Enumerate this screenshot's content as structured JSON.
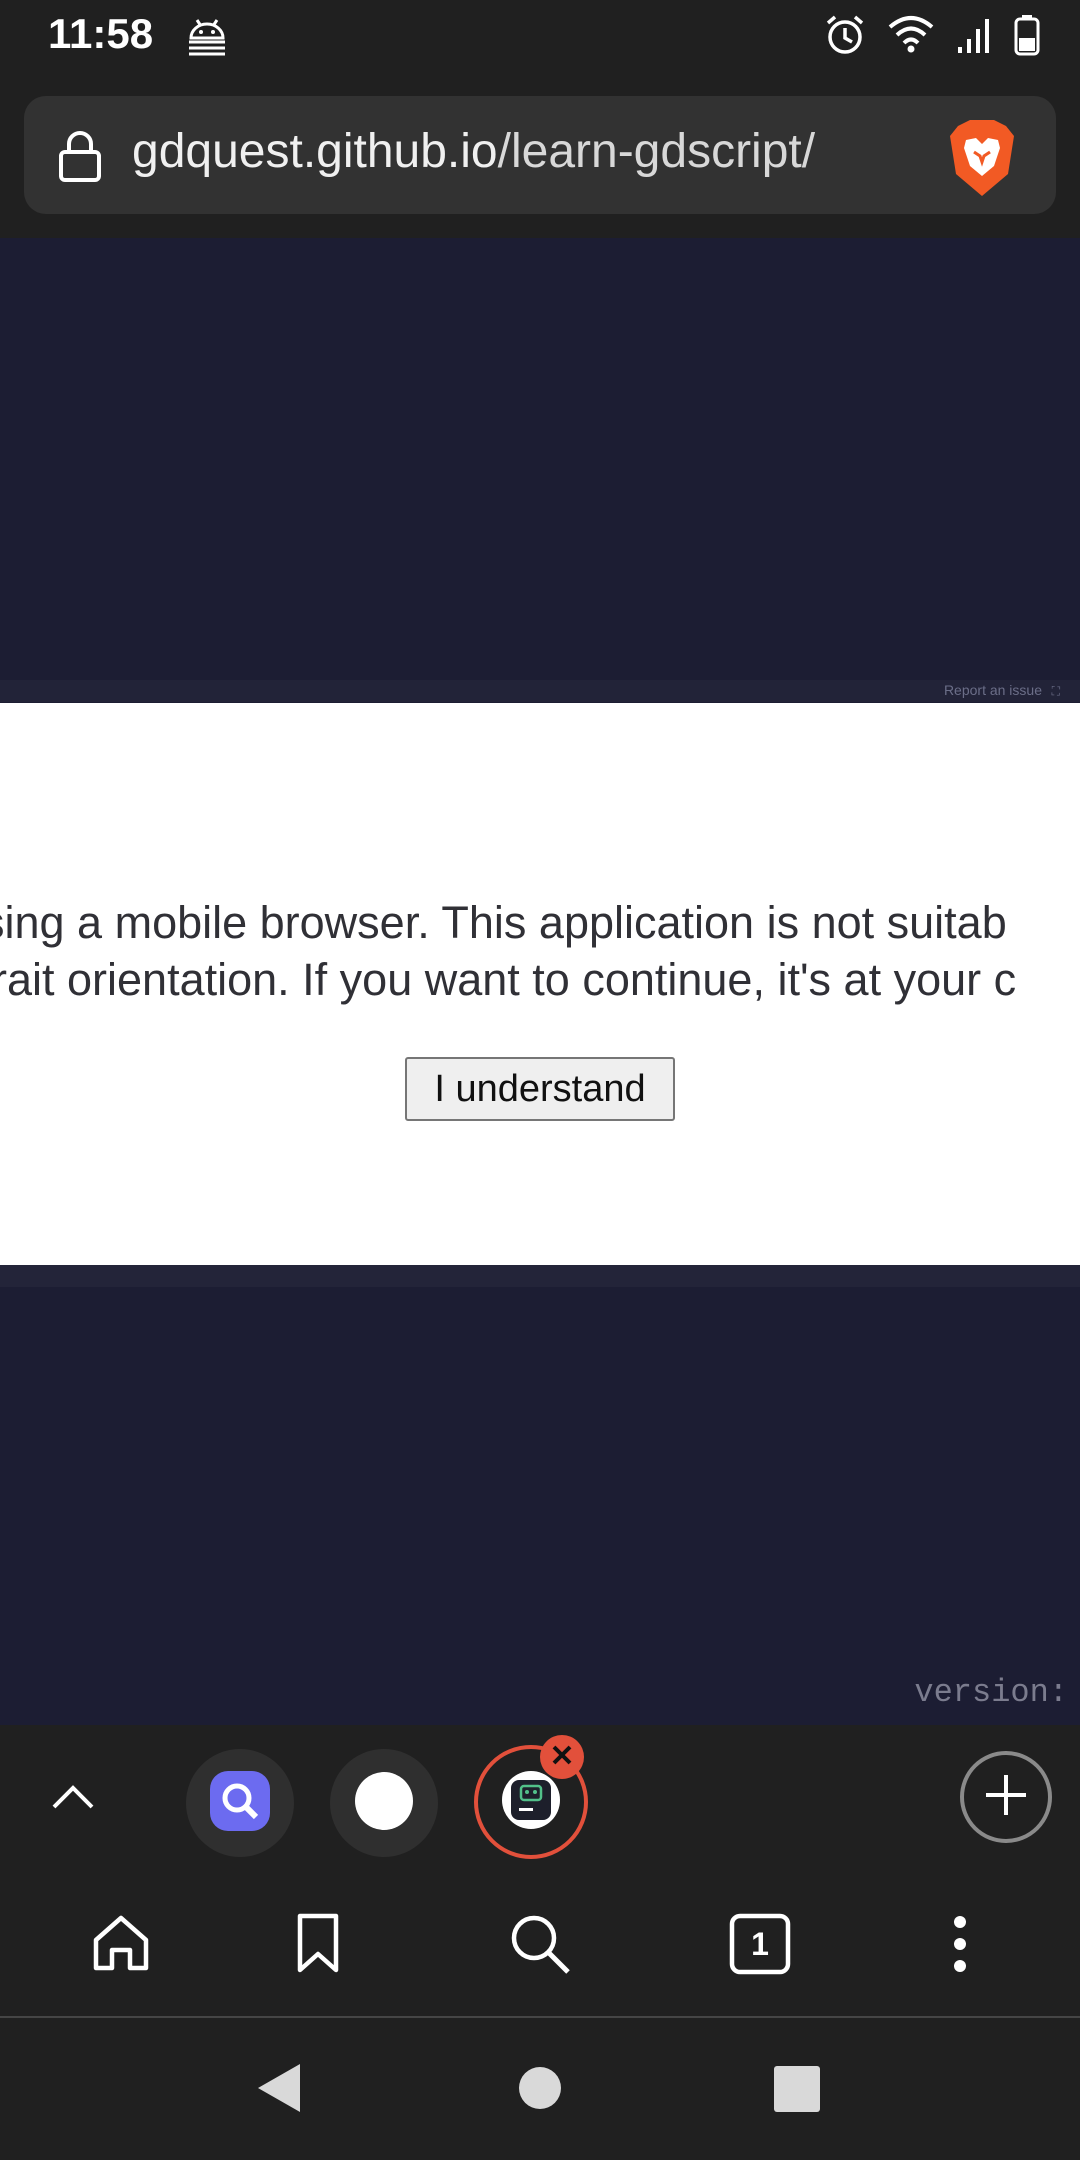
{
  "status_bar": {
    "time": "11:58",
    "icons": [
      "android-debug-icon",
      "alarm-icon",
      "wifi-icon",
      "signal-icon",
      "battery-icon"
    ]
  },
  "address_bar": {
    "domain": "gdquest.github.io",
    "path": "/learn-gdscript/",
    "icons": [
      "lock-icon",
      "brave-lion-icon"
    ]
  },
  "page": {
    "report_issue": "Report an issue",
    "dialog": {
      "line1": "sing a mobile browser. This application is not suitab",
      "line2": "rait orientation. If you want to continue, it's at your c",
      "button_label": "I understand"
    },
    "version_label": "version:"
  },
  "tab_strip": {
    "tabs": [
      {
        "icon": "search-app-icon",
        "active": false
      },
      {
        "icon": "blank-circle-icon",
        "active": false
      },
      {
        "icon": "godot-app-icon",
        "active": true
      }
    ]
  },
  "bottom_toolbar": {
    "tab_count": "1",
    "icons": [
      "home-icon",
      "bookmark-icon",
      "search-icon",
      "tabs-icon",
      "more-icon"
    ]
  },
  "colors": {
    "page_bg": "#1c1d33",
    "chrome_bg": "#202020",
    "accent": "#e2503b",
    "dialog_bg": "#ffffff"
  }
}
